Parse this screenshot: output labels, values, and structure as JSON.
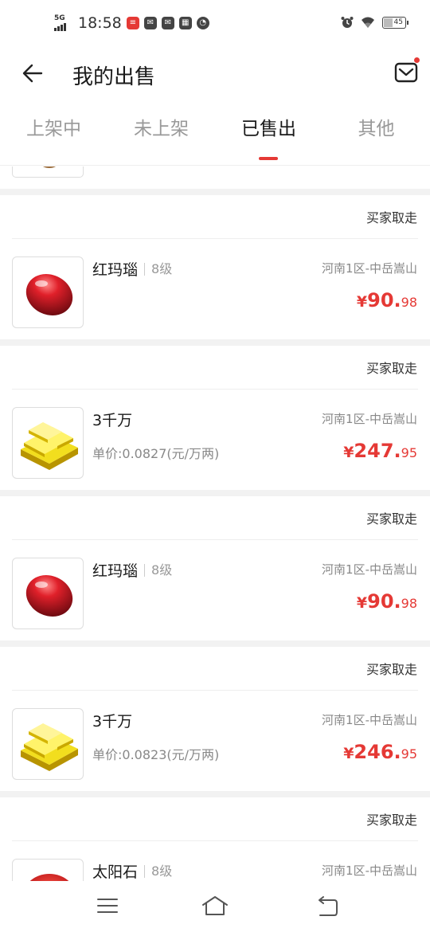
{
  "status_bar": {
    "network": "5G",
    "time": "18:58",
    "battery": "45"
  },
  "header": {
    "title": "我的出售",
    "back_icon": "arrow-left-icon",
    "mail_icon": "mail-icon"
  },
  "tabs": [
    {
      "label": "上架中",
      "active": false
    },
    {
      "label": "未上架",
      "active": false
    },
    {
      "label": "已售出",
      "active": true
    },
    {
      "label": "其他",
      "active": false
    }
  ],
  "orders": [
    {
      "status": "买家取走",
      "item": "红玛瑙",
      "level": "8级",
      "server": "河南1区-中岳嵩山",
      "price_symbol": "¥",
      "price_int": "90.",
      "price_dec": "98",
      "image": "red-agate-icon"
    },
    {
      "status": "买家取走",
      "item": "3千万",
      "unit_price": "单价:0.0827(元/万两)",
      "server": "河南1区-中岳嵩山",
      "price_symbol": "¥",
      "price_int": "247.",
      "price_dec": "95",
      "image": "gold-bars-icon"
    },
    {
      "status": "买家取走",
      "item": "红玛瑙",
      "level": "8级",
      "server": "河南1区-中岳嵩山",
      "price_symbol": "¥",
      "price_int": "90.",
      "price_dec": "98",
      "image": "red-agate-icon"
    },
    {
      "status": "买家取走",
      "item": "3千万",
      "unit_price": "单价:0.0823(元/万两)",
      "server": "河南1区-中岳嵩山",
      "price_symbol": "¥",
      "price_int": "246.",
      "price_dec": "95",
      "image": "gold-bars-icon"
    },
    {
      "status": "买家取走",
      "item": "太阳石",
      "level": "8级",
      "server": "河南1区-中岳嵩山",
      "image": "sun-stone-icon"
    }
  ],
  "colors": {
    "accent": "#e53935",
    "divider": "#f2f2f2"
  }
}
